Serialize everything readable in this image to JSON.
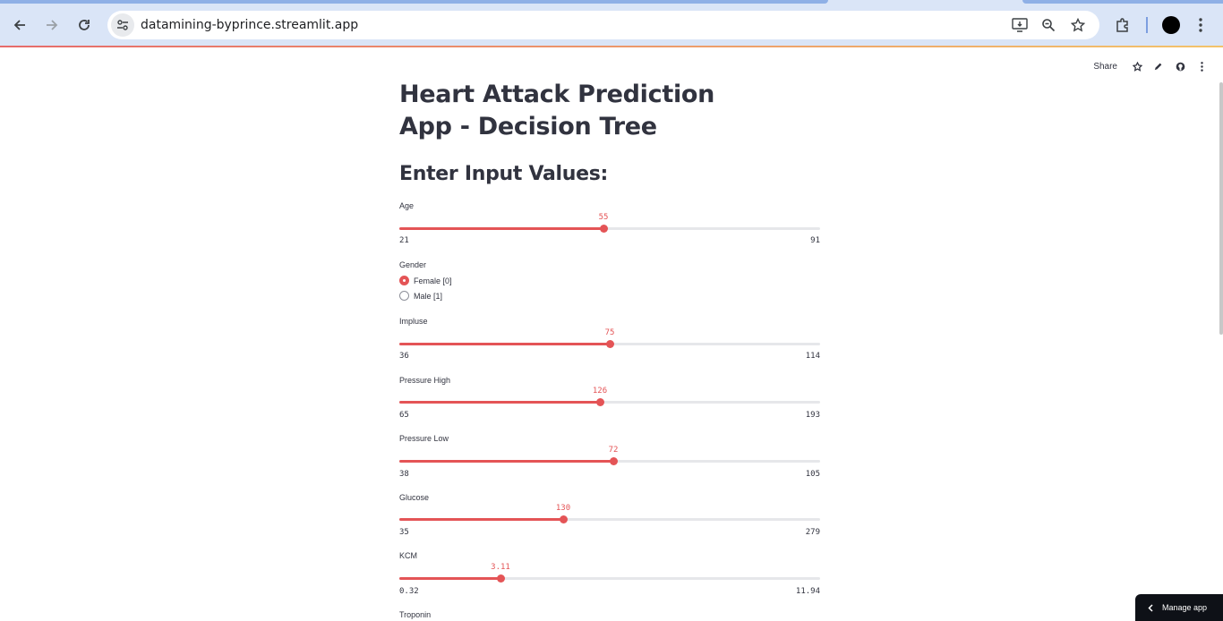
{
  "browser": {
    "url": "datamining-byprince.streamlit.app",
    "icons": {
      "back": "arrow-left-icon",
      "forward": "arrow-right-icon",
      "reload": "reload-icon",
      "site_info": "tune-icon",
      "install": "install-app-icon",
      "zoom": "zoom-icon",
      "bookmark": "star-icon",
      "extensions": "puzzle-icon",
      "menu": "kebab-menu-icon"
    }
  },
  "toolbar": {
    "share_label": "Share"
  },
  "page": {
    "title": "Heart Attack Prediction App - Decision Tree",
    "subheader": "Enter Input Values:"
  },
  "inputs": {
    "age": {
      "label": "Age",
      "value": "55",
      "min": "21",
      "max": "91",
      "fraction": 0.4857
    },
    "gender": {
      "label": "Gender",
      "options": [
        "Female [0]",
        "Male [1]"
      ],
      "selected": "Female [0]"
    },
    "impulse": {
      "label": "Impluse",
      "value": "75",
      "min": "36",
      "max": "114",
      "fraction": 0.5
    },
    "pressure_high": {
      "label": "Pressure High",
      "value": "126",
      "min": "65",
      "max": "193",
      "fraction": 0.4766
    },
    "pressure_low": {
      "label": "Pressure Low",
      "value": "72",
      "min": "38",
      "max": "105",
      "fraction": 0.5075
    },
    "glucose": {
      "label": "Glucose",
      "value": "130",
      "min": "35",
      "max": "279",
      "fraction": 0.3893
    },
    "kcm": {
      "label": "KCM",
      "value": "3.11",
      "min": "0.32",
      "max": "11.94",
      "fraction": 0.2401
    },
    "troponin": {
      "label": "Troponin"
    }
  },
  "manage_app": {
    "label": "Manage app"
  },
  "colors": {
    "accent": "#e45456",
    "text": "#31333f",
    "track": "#e6e7ea",
    "chrome": "#dae5f7"
  }
}
